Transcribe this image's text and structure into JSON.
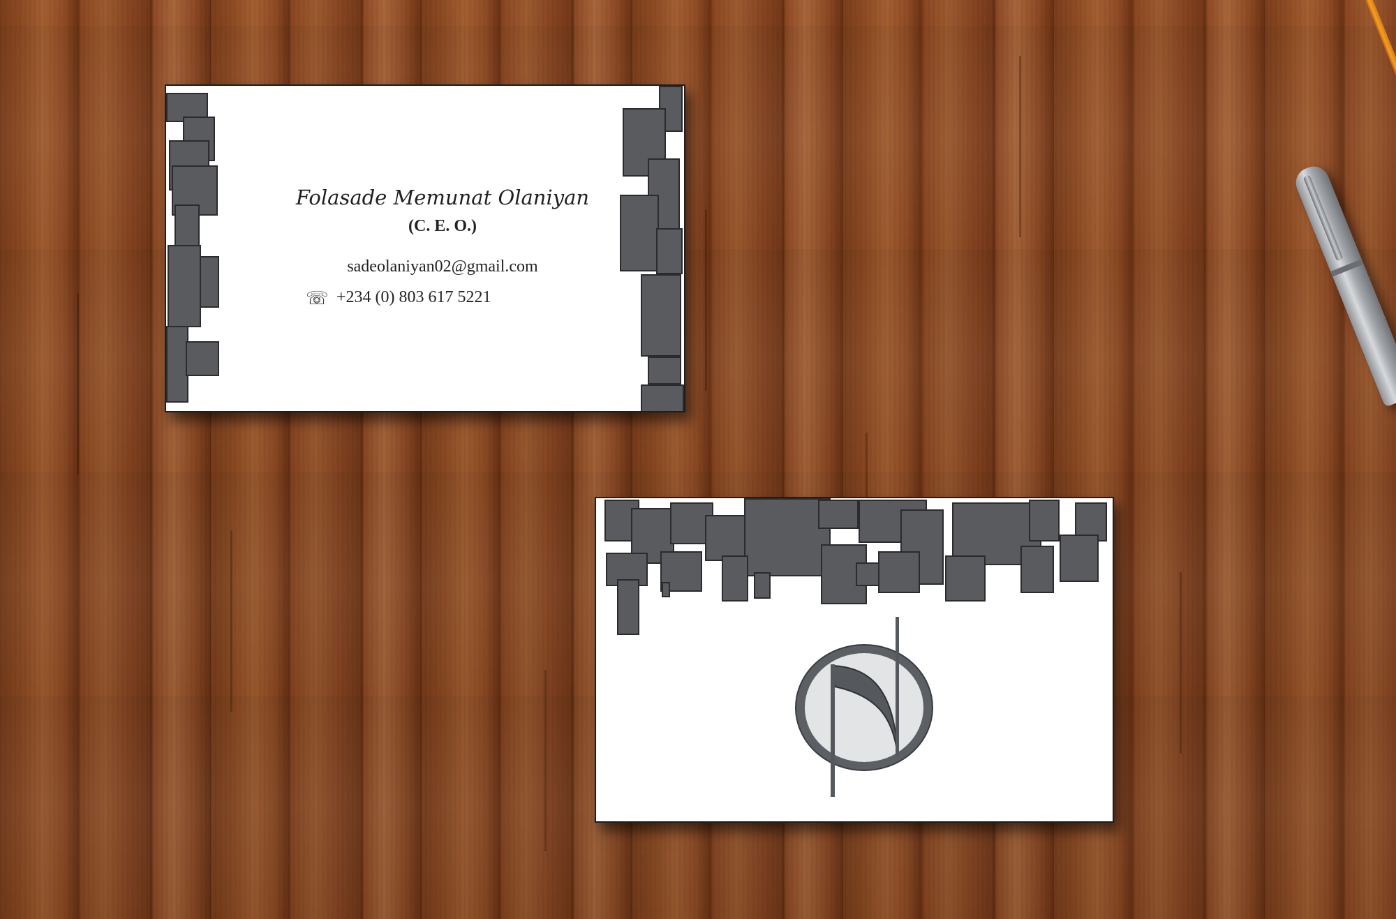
{
  "scene": {
    "desk_colors": {
      "light": "#a35e31",
      "mid": "#8c4a22",
      "dark": "#5e2c11"
    },
    "objects": [
      "pencil-icon",
      "pen-icon"
    ]
  },
  "front_card": {
    "name": "Folasade Memunat Olaniyan",
    "title": "(C. E. O.)",
    "email": "sadeolaniyan02@gmail.com",
    "phone_icon": "☏",
    "phone": "+234 (0) 803 617 5221"
  },
  "back_card": {
    "logo": "note-monogram-icon"
  },
  "colors": {
    "card": "#ffffff",
    "block_fill": "#5a5b5f",
    "block_border": "#2b2b2d",
    "logo_ring": "#5c5f63",
    "logo_fill": "#e3e4e5"
  }
}
